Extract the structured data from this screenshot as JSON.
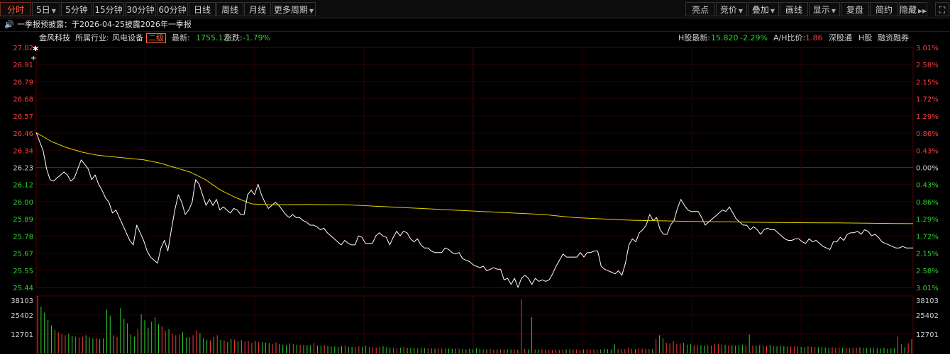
{
  "toolbar": {
    "left": [
      {
        "label": "分时",
        "active": true,
        "caret": false
      },
      {
        "label": "5日",
        "active": false,
        "caret": true
      },
      {
        "label": "5分钟",
        "active": false,
        "caret": false
      },
      {
        "label": "15分钟",
        "active": false,
        "caret": false
      },
      {
        "label": "30分钟",
        "active": false,
        "caret": false
      },
      {
        "label": "60分钟",
        "active": false,
        "caret": false
      },
      {
        "label": "日线",
        "active": false,
        "caret": false
      },
      {
        "label": "周线",
        "active": false,
        "caret": false
      },
      {
        "label": "月线",
        "active": false,
        "caret": false
      },
      {
        "label": "更多周期",
        "active": false,
        "caret": true
      }
    ],
    "right": [
      {
        "label": "亮点",
        "caret": false
      },
      {
        "label": "竞价",
        "caret": true
      },
      {
        "label": "叠加",
        "caret": true
      },
      {
        "label": "画线",
        "caret": false
      },
      {
        "label": "显示",
        "caret": true
      },
      {
        "label": "复盘",
        "caret": false
      },
      {
        "label": "简约",
        "caret": false
      },
      {
        "label": "隐藏",
        "caret": false
      }
    ]
  },
  "notice": {
    "text": "一季报预披露：于2026-04-25披露2026年一季报"
  },
  "info": {
    "name": "金风科技",
    "industry_label": "所属行业:",
    "industry": "风电设备",
    "level": "二级",
    "latest_label": "最新:",
    "latest": "1755.12",
    "change_label": "涨跌:",
    "change": "-1.79%",
    "h_latest_label": "H股最新:",
    "h_latest": "15.820",
    "h_change": "-2.29%",
    "ah_label": "A/H比价:",
    "ah": "1.86",
    "links": [
      "深股通",
      "H股",
      "融资融券"
    ]
  },
  "colors": {
    "up": "#ff3b3b",
    "down": "#2fd22f",
    "price": "#ffffff",
    "avg": "#e6d200",
    "grid": "#3a0000",
    "neutral": "#d0d0d0"
  },
  "chart_data": {
    "type": "line",
    "price_ticks": [
      "27.02",
      "26.91",
      "26.79",
      "26.68",
      "26.57",
      "26.46",
      "26.34",
      "26.23",
      "26.12",
      "26.00",
      "25.89",
      "25.78",
      "25.67",
      "25.55",
      "25.44"
    ],
    "pct_ticks": [
      "3.01%",
      "2.58%",
      "2.15%",
      "1.72%",
      "1.29%",
      "0.86%",
      "0.43%",
      "0.00%",
      "0.43%",
      "0.86%",
      "1.29%",
      "1.72%",
      "2.15%",
      "2.58%",
      "3.01%"
    ],
    "ylim": [
      25.44,
      27.02
    ],
    "prev_close": 26.23,
    "volume_ticks": [
      "38103",
      "25402",
      "12701"
    ],
    "volume_max": 38103,
    "series": [
      {
        "key": "price",
        "values": [
          26.46,
          26.4,
          26.34,
          26.22,
          26.15,
          26.14,
          26.16,
          26.18,
          26.2,
          26.18,
          26.14,
          26.16,
          26.22,
          26.28,
          26.25,
          26.22,
          26.15,
          26.18,
          26.12,
          26.08,
          26.03,
          26.0,
          25.93,
          25.95,
          25.9,
          25.85,
          25.8,
          25.75,
          25.72,
          25.85,
          25.8,
          25.75,
          25.68,
          25.64,
          25.62,
          25.6,
          25.7,
          25.75,
          25.68,
          25.82,
          25.95,
          26.05,
          26.0,
          25.92,
          25.95,
          26.0,
          26.15,
          26.12,
          26.05,
          25.98,
          26.02,
          25.98,
          26.02,
          25.95,
          25.97,
          25.95,
          25.93,
          25.96,
          25.95,
          25.92,
          25.92,
          26.05,
          26.08,
          26.05,
          26.12,
          26.05,
          26.0,
          25.96,
          25.98,
          26.0,
          25.98,
          25.95,
          25.92,
          25.9,
          25.92,
          25.9,
          25.9,
          25.88,
          25.87,
          25.85,
          25.85,
          25.84,
          25.82,
          25.83,
          25.8,
          25.78,
          25.76,
          25.74,
          25.72,
          25.75,
          25.73,
          25.72,
          25.72,
          25.78,
          25.77,
          25.73,
          25.73,
          25.73,
          25.78,
          25.8,
          25.78,
          25.77,
          25.72,
          25.77,
          25.81,
          25.78,
          25.81,
          25.8,
          25.76,
          25.74,
          25.76,
          25.72,
          25.7,
          25.7,
          25.68,
          25.67,
          25.67,
          25.67,
          25.7,
          25.69,
          25.67,
          25.66,
          25.67,
          25.63,
          25.62,
          25.61,
          25.59,
          25.58,
          25.57,
          25.58,
          25.55,
          25.56,
          25.57,
          25.56,
          25.56,
          25.49,
          25.5,
          25.46,
          25.5,
          25.44,
          25.5,
          25.52,
          25.5,
          25.46,
          25.5,
          25.48,
          25.49,
          25.48,
          25.49,
          25.53,
          25.58,
          25.62,
          25.66,
          25.64,
          25.64,
          25.64,
          25.64,
          25.67,
          25.64,
          25.67,
          25.67,
          25.68,
          25.68,
          25.58,
          25.56,
          25.55,
          25.54,
          25.53,
          25.55,
          25.52,
          25.6,
          25.72,
          25.76,
          25.74,
          25.8,
          25.82,
          25.85,
          25.92,
          25.88,
          25.9,
          25.82,
          25.79,
          25.79,
          25.85,
          25.88,
          25.96,
          26.02,
          25.98,
          25.95,
          25.94,
          25.94,
          25.94,
          25.9,
          25.85,
          25.87,
          25.89,
          25.91,
          25.93,
          25.95,
          25.94,
          25.97,
          25.93,
          25.89,
          25.87,
          25.85,
          25.85,
          25.82,
          25.84,
          25.82,
          25.79,
          25.82,
          25.83,
          25.82,
          25.82,
          25.8,
          25.78,
          25.76,
          25.75,
          25.75,
          25.76,
          25.76,
          25.74,
          25.73,
          25.76,
          25.74,
          25.75,
          25.73,
          25.71,
          25.7,
          25.69,
          25.74,
          25.74,
          25.77,
          25.75,
          25.79,
          25.8,
          25.8,
          25.81,
          25.79,
          25.82,
          25.81,
          25.78,
          25.79,
          25.77,
          25.74,
          25.73,
          25.72,
          25.71,
          25.7,
          25.7,
          25.71,
          25.7,
          25.7,
          25.7
        ]
      },
      {
        "key": "avg",
        "values": [
          26.46,
          26.4,
          26.36,
          26.33,
          26.31,
          26.3,
          26.29,
          26.28,
          26.26,
          26.23,
          26.2,
          26.15,
          26.08,
          26.03,
          25.99,
          25.985,
          25.985,
          25.986,
          25.986,
          25.985,
          25.985,
          25.98,
          25.975,
          25.97,
          25.965,
          25.96,
          25.955,
          25.95,
          25.945,
          25.94,
          25.935,
          25.93,
          25.925,
          25.92,
          25.91,
          25.9,
          25.895,
          25.89,
          25.885,
          25.882,
          25.88,
          25.878,
          25.876,
          25.875,
          25.873,
          25.872,
          25.87,
          25.869,
          25.868,
          25.867,
          25.866,
          25.865,
          25.865,
          25.864,
          25.863,
          25.862,
          25.861,
          25.86
        ]
      }
    ],
    "volume": [
      38103,
      31000,
      27000,
      22000,
      18500,
      15500,
      14000,
      13000,
      12000,
      13000,
      11500,
      11000,
      10500,
      11000,
      12000,
      10500,
      9800,
      10200,
      9500,
      9800,
      29000,
      25000,
      12000,
      11000,
      30000,
      23000,
      20000,
      12500,
      11000,
      16000,
      26000,
      22000,
      17000,
      21000,
      24000,
      19500,
      18000,
      15000,
      16000,
      13000,
      12000,
      12500,
      14000,
      10500,
      11000,
      12000,
      15000,
      13500,
      10000,
      9000,
      8500,
      11000,
      12000,
      9000,
      8500,
      7500,
      9500,
      9000,
      8000,
      8800,
      7800,
      8200,
      7000,
      8000,
      7500,
      7400,
      7200,
      6800,
      6000,
      7200,
      6200,
      5800,
      5400,
      6500,
      6000,
      5800,
      5600,
      5400,
      5500,
      5300,
      7000,
      5200,
      5000,
      5500,
      4800,
      4600,
      4500,
      4400,
      4800,
      5200,
      4300,
      4200,
      4100,
      4600,
      4400,
      5000,
      4200,
      4000,
      3800,
      4200,
      4600,
      4000,
      3800,
      3600,
      3400,
      3800,
      4200,
      3600,
      3500,
      3300,
      3200,
      3600,
      3400,
      3300,
      3200,
      3100,
      3200,
      3000,
      3300,
      3100,
      2900,
      3000,
      3100,
      2800,
      2600,
      2900,
      2700,
      3400,
      3000,
      2700,
      2600,
      2800,
      2400,
      2500,
      2600,
      2600,
      2700,
      2500,
      2600,
      2400,
      36000,
      2800,
      2500,
      24000,
      2600,
      2400,
      2600,
      2300,
      2400,
      2200,
      2500,
      2300,
      2600,
      2700,
      2800,
      2600,
      2500,
      2400,
      2600,
      2700,
      2500,
      2600,
      2400,
      2600,
      3000,
      2700,
      2500,
      6000,
      2800,
      2600,
      2700,
      3500,
      3000,
      2800,
      3200,
      3100,
      3000,
      2900,
      2800,
      9500,
      12000,
      10000,
      7000,
      6500,
      8000,
      6000,
      6500,
      7000,
      5800,
      6000,
      5200,
      5600,
      5400,
      5000,
      5400,
      5200,
      6000,
      6200,
      5800,
      5600,
      5200,
      5400,
      5000,
      5600,
      5800,
      5300,
      12500,
      5200,
      5000,
      5400,
      5200,
      4800,
      5600,
      4800,
      4600,
      5000,
      4700,
      4500,
      4400,
      4700,
      4500,
      4200,
      4000,
      4600,
      4300,
      4200,
      4000,
      4100,
      3900,
      3600,
      4100,
      3800,
      3700,
      3700,
      3600,
      3500,
      3800,
      3700,
      4000,
      3600,
      3500,
      3700,
      3900,
      3400,
      3200,
      3600,
      3000,
      3200,
      3400,
      11000,
      6000,
      4000,
      6500,
      9500
    ]
  }
}
